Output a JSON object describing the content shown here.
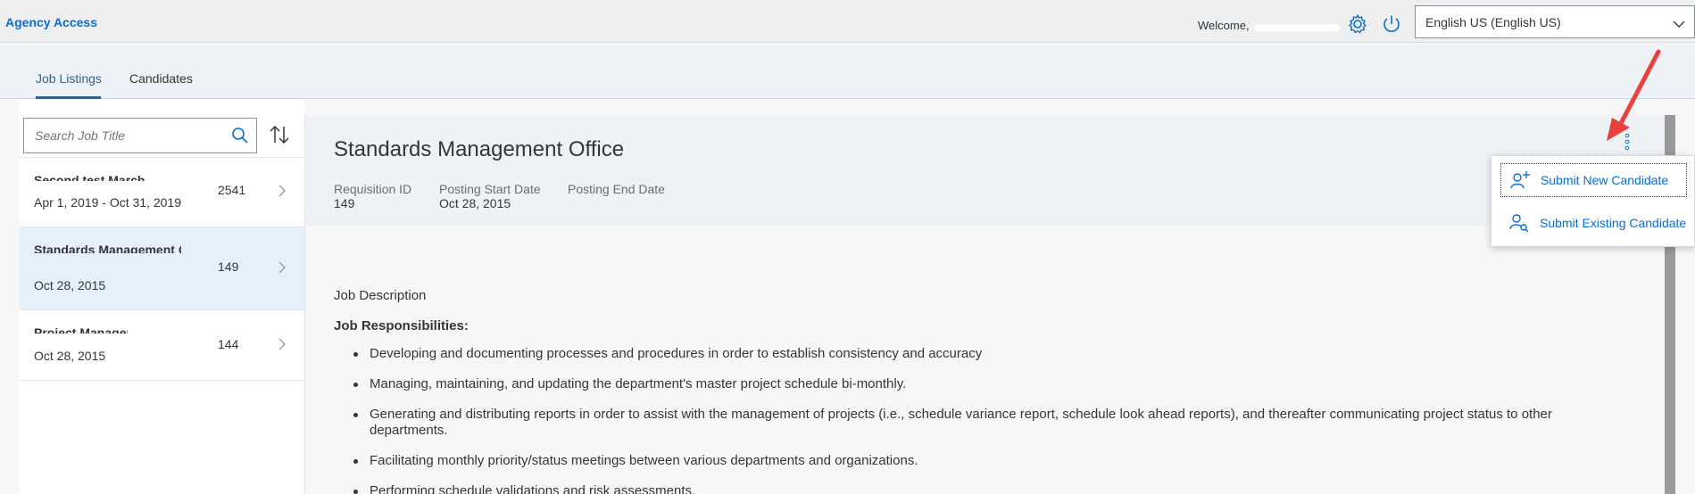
{
  "shellbar": {
    "app_title": "Agency Access",
    "welcome": "Welcome,",
    "language": "English US (English US)",
    "icons": [
      "gear-icon",
      "power-icon",
      "chevron-down-icon"
    ]
  },
  "tabs": [
    {
      "label": "Job Listings",
      "active": true
    },
    {
      "label": "Candidates",
      "active": false
    }
  ],
  "search": {
    "placeholder": "Search Job Title"
  },
  "jobs": [
    {
      "title": "Second test March",
      "dates": "Apr 1, 2019 - Oct 31, 2019",
      "count": "2541",
      "selected": false
    },
    {
      "title": "Standards Management Office",
      "dates": "Oct 28, 2015",
      "count": "149",
      "selected": true
    },
    {
      "title": "Project Manager",
      "dates": "Oct 28, 2015",
      "count": "144",
      "selected": false
    }
  ],
  "detail": {
    "title": "Standards Management Office",
    "requisition_label": "Requisition ID",
    "requisition_value": "149",
    "start_label": "Posting Start Date",
    "start_value": "Oct 28, 2015",
    "end_label": "Posting End Date",
    "end_value": "",
    "desc_label": "Job Description",
    "resp_label": "Job Responsibilities:",
    "responsibilities": [
      "Developing and documenting processes and procedures in order to establish consistency and accuracy",
      "Managing, maintaining, and updating the department's master project schedule bi-monthly.",
      "Generating and distributing reports in order to assist with the management of projects (i.e., schedule variance report, schedule look ahead reports), and thereafter communicating project status to other departments.",
      "Facilitating monthly priority/status meetings between various departments and organizations.",
      "Performing schedule validations and risk assessments."
    ]
  },
  "menu": {
    "items": [
      {
        "label": "Submit New Candidate",
        "icon": "add-person-icon"
      },
      {
        "label": "Submit Existing Candidate",
        "icon": "search-person-icon"
      }
    ]
  },
  "colors": {
    "accent": "#0a6ed1",
    "tab_active": "#346187",
    "arrow": "#e8403a"
  }
}
